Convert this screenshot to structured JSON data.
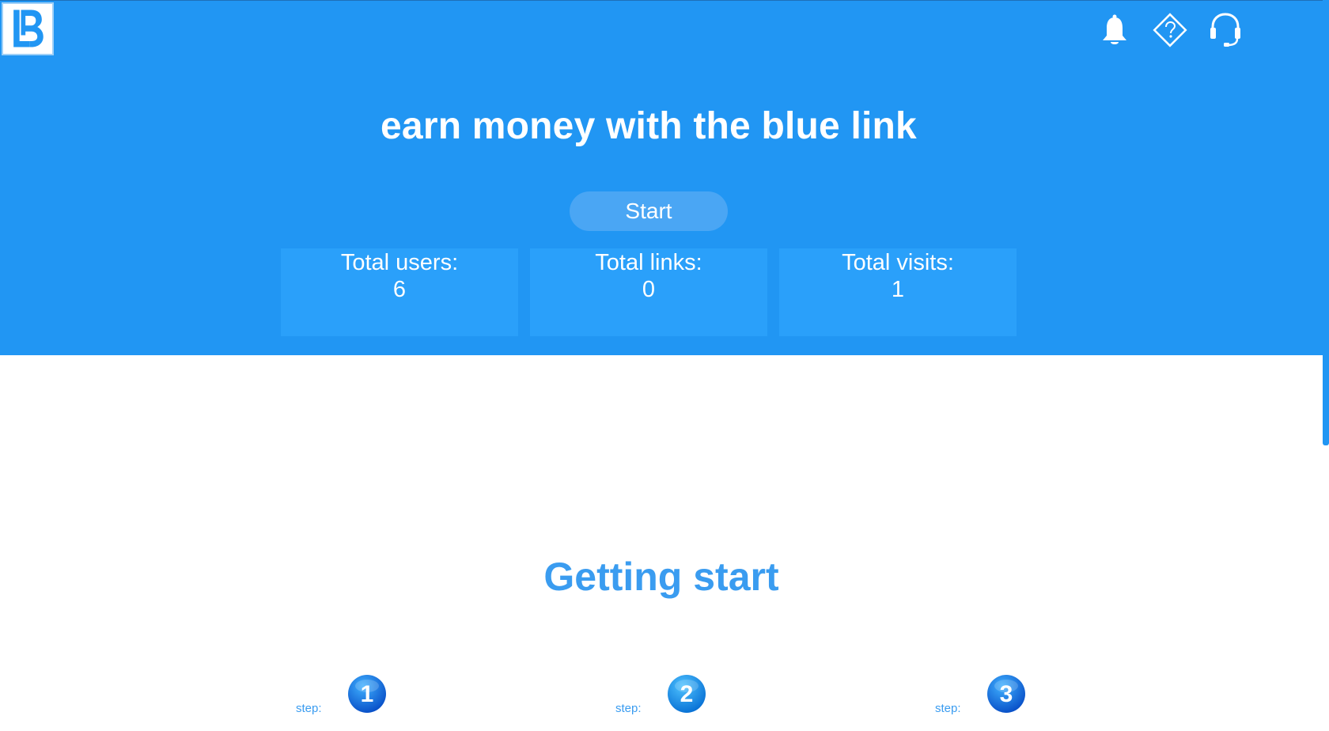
{
  "header": {
    "logo_icon": "bl-logo-icon",
    "icons": [
      {
        "name": "bell-icon"
      },
      {
        "name": "help-diamond-icon"
      },
      {
        "name": "headset-icon"
      }
    ]
  },
  "hero": {
    "title": "earn money with the blue link",
    "start_label": "Start",
    "stats": [
      {
        "label": "Total users:",
        "value": "6"
      },
      {
        "label": "Total links:",
        "value": "0"
      },
      {
        "label": "Total visits:",
        "value": "1"
      }
    ]
  },
  "getting_started": {
    "title": "Getting start",
    "steps": [
      {
        "label": "step:",
        "number": "1"
      },
      {
        "label": "step:",
        "number": "2"
      },
      {
        "label": "step:",
        "number": "3"
      }
    ]
  },
  "colors": {
    "primary": "#2196f3",
    "card": "#2aa0fa",
    "button": "#4aa6f4",
    "heading": "#3a9cf0"
  }
}
